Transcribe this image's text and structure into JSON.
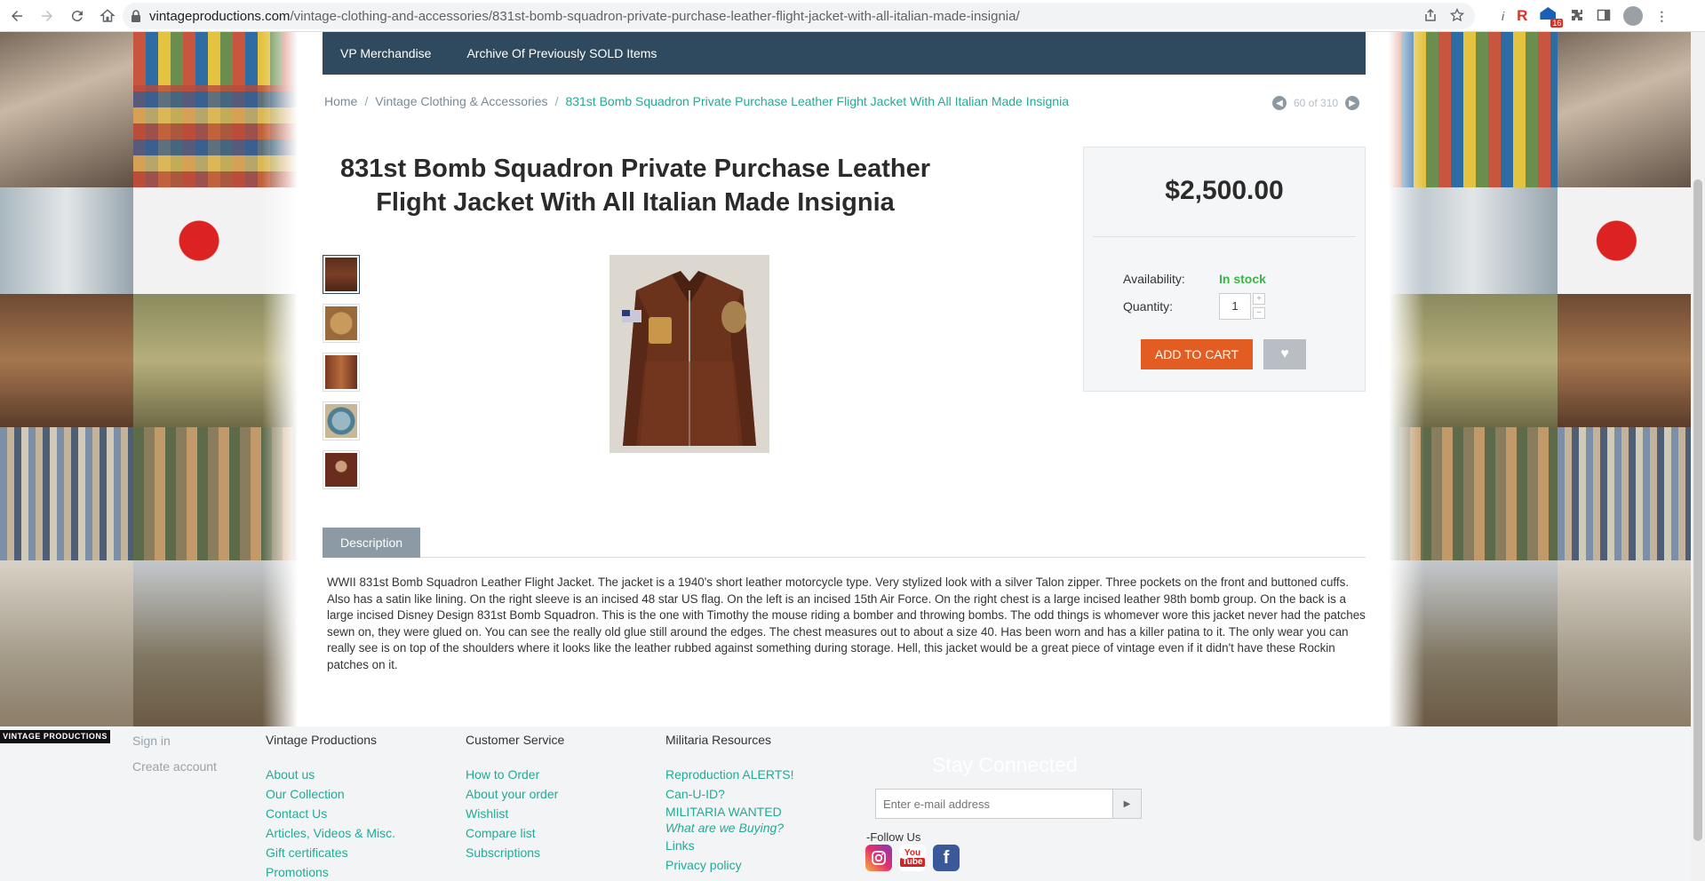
{
  "browser": {
    "url_host": "vintageproductions.com",
    "url_path": "/vintage-clothing-and-accessories/831st-bomb-squadron-private-purchase-leather-flight-jacket-with-all-italian-made-insignia/",
    "extension_badge": "16",
    "ext_r": "R",
    "ext_i": "i"
  },
  "topnav": {
    "items": [
      "VP Merchandise",
      "Archive Of Previously SOLD Items"
    ]
  },
  "breadcrumb": {
    "home": "Home",
    "sep1": "/",
    "category": "Vintage Clothing & Accessories",
    "sep2": "/",
    "current": "831st Bomb Squadron Private Purchase Leather Flight Jacket With All Italian Made Insignia"
  },
  "pager": {
    "text": "60 of 310"
  },
  "product": {
    "title": "831st Bomb Squadron Private Purchase Leather Flight Jacket With All Italian Made Insignia",
    "price": "$2,500.00",
    "availability_label": "Availability:",
    "availability_value": "In stock",
    "quantity_label": "Quantity:",
    "quantity_value": "1",
    "qty_up": "+",
    "qty_down": "−",
    "add_to_cart": "ADD TO CART",
    "wishlist_icon": "heart-icon"
  },
  "tabs": {
    "description": "Description"
  },
  "description": "WWII 831st Bomb Squadron Leather Flight Jacket. The jacket is a 1940's short leather motorcycle type. Very stylized look with a silver Talon zipper. Three pockets on the front and buttoned cuffs. Also has a satin like lining. On the right sleeve is an incised 48 star US flag. On the left is an incised 15th Air Force. On the right chest is a large incised leather 98th bomb group. On the back is a large incised Disney Design 831st Bomb Squadron. This is the one with Timothy the mouse riding a bomber and throwing bombs. The odd things is whomever wore this jacket never had the patches sewn on, they were glued on. You can see the really old glue still around the edges. The chest measures out to about a size 40. Has been worn and has a killer patina to it. The only wear you can really see is on top of the shoulders where it looks like the leather rubbed against something during storage. Hell, this jacket would be a great piece of vintage even if it didn't have these Rockin patches on it.",
  "footer": {
    "logo": "VINTAGE PRODUCTIONS",
    "account": [
      "Sign in",
      "Create account"
    ],
    "vp": {
      "head": "Vintage Productions",
      "links": [
        "About us",
        "Our Collection",
        "Contact Us",
        "Articles, Videos & Misc.",
        "Gift certificates",
        "Promotions"
      ]
    },
    "cs": {
      "head": "Customer Service",
      "links": [
        "How to Order",
        "About your order",
        "Wishlist",
        "Compare list",
        "Subscriptions"
      ]
    },
    "mil": {
      "head": "Militaria Resources",
      "links": [
        "Reproduction ALERTS!",
        "Can-U-ID?",
        "MILITARIA WANTED"
      ],
      "italic": "What are we Buying?",
      "links2": [
        "Links",
        "Privacy policy"
      ]
    },
    "stay": "Stay Connected",
    "email_placeholder": "Enter e-mail address",
    "follow": "-Follow Us",
    "social": [
      "instagram-icon",
      "youtube-icon",
      "facebook-icon"
    ],
    "yt_label_top": "You",
    "yt_label_bottom": "Tube",
    "fb_letter": "f"
  }
}
